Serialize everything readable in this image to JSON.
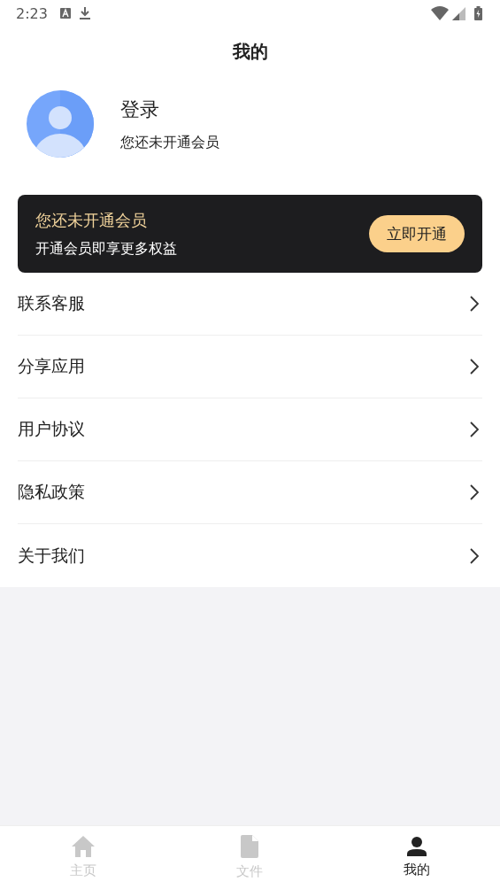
{
  "status_bar": {
    "time": "2:23"
  },
  "title": "我的",
  "profile": {
    "name": "登录",
    "subtitle": "您还未开通会员"
  },
  "vip_card": {
    "title": "您还未开通会员",
    "subtitle": "开通会员即享更多权益",
    "button": "立即开通"
  },
  "menu": [
    {
      "label": "联系客服"
    },
    {
      "label": "分享应用"
    },
    {
      "label": "用户协议"
    },
    {
      "label": "隐私政策"
    },
    {
      "label": "关于我们"
    }
  ],
  "tabs": [
    {
      "label": "主页",
      "kind": "home",
      "selected": false
    },
    {
      "label": "文件",
      "kind": "file",
      "selected": false
    },
    {
      "label": "我的",
      "kind": "person",
      "selected": true
    }
  ]
}
